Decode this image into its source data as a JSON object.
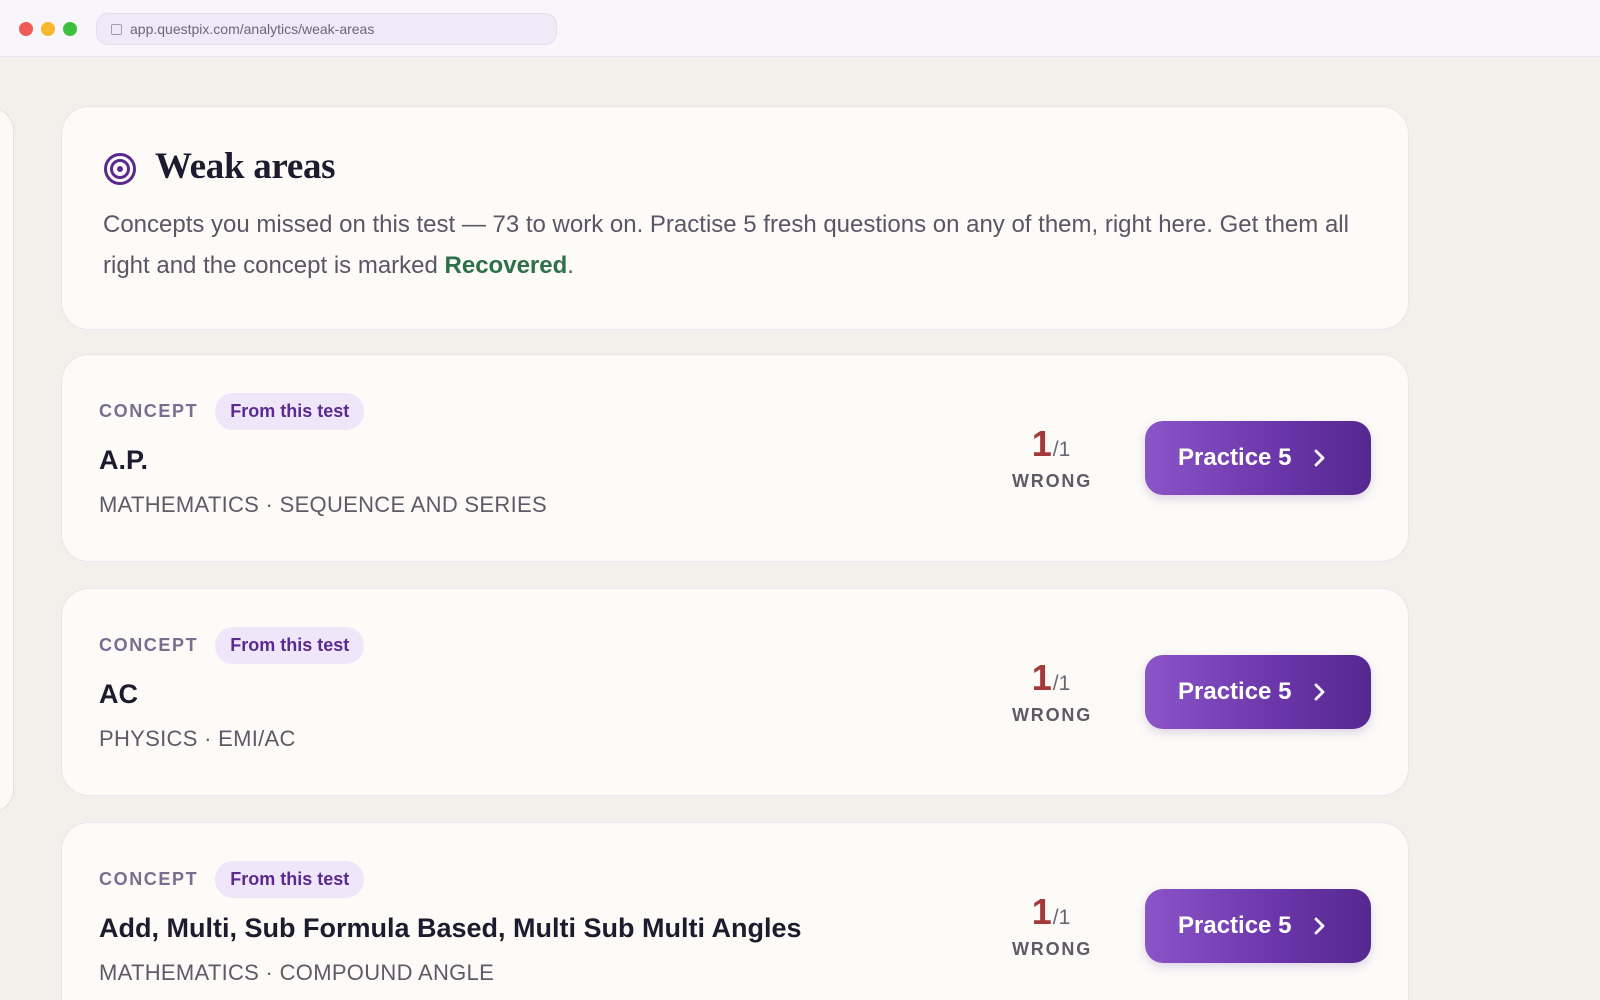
{
  "browser": {
    "url": "app.questpix.com/analytics/weak-areas"
  },
  "header": {
    "title": "Weak areas",
    "desc_pre": "Concepts you missed on this test — 73 to work on. Practise 5 fresh questions on any of them, right here. Get them all right and the concept is marked ",
    "desc_highlight": "Recovered",
    "desc_post": "."
  },
  "concepts": [
    {
      "label": "CONCEPT",
      "tag": "From this test",
      "name": "A.P.",
      "meta": "MATHEMATICS · SEQUENCE AND SERIES",
      "wrong": "1",
      "total": "/1",
      "wrong_label": "WRONG",
      "button": "Practice 5"
    },
    {
      "label": "CONCEPT",
      "tag": "From this test",
      "name": "AC",
      "meta": "PHYSICS · EMI/AC",
      "wrong": "1",
      "total": "/1",
      "wrong_label": "WRONG",
      "button": "Practice 5"
    },
    {
      "label": "CONCEPT",
      "tag": "From this test",
      "name": "Add, Multi, Sub Formula Based, Multi Sub Multi Angles",
      "meta": "MATHEMATICS · COMPOUND ANGLE",
      "wrong": "1",
      "total": "/1",
      "wrong_label": "WRONG",
      "button": "Practice 5"
    }
  ],
  "colors": {
    "accent": "#6a35a8",
    "wrong": "#a33a3a",
    "recovered": "#2e7048"
  }
}
